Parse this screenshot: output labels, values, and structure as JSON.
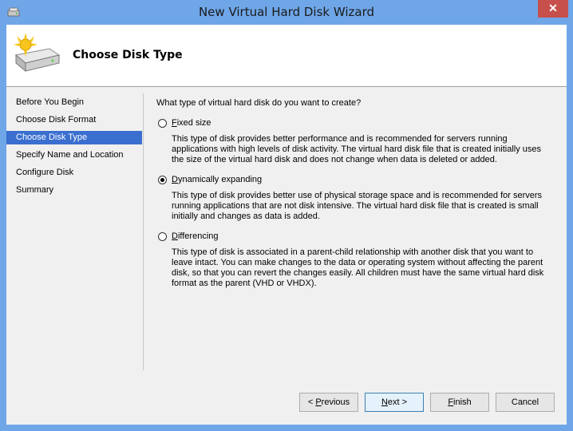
{
  "window": {
    "title": "New Virtual Hard Disk Wizard",
    "close_glyph": "✕",
    "title_icon": "hard-disk-icon"
  },
  "header": {
    "title": "Choose Disk Type",
    "icon": "new-hard-disk-icon"
  },
  "nav": {
    "items": [
      {
        "label": "Before You Begin",
        "selected": false
      },
      {
        "label": "Choose Disk Format",
        "selected": false
      },
      {
        "label": "Choose Disk Type",
        "selected": true
      },
      {
        "label": "Specify Name and Location",
        "selected": false
      },
      {
        "label": "Configure Disk",
        "selected": false
      },
      {
        "label": "Summary",
        "selected": false
      }
    ]
  },
  "main": {
    "question": "What type of virtual hard disk do you want to create?",
    "options": [
      {
        "label_accel": "F",
        "label_rest": "ixed size",
        "checked": false,
        "description": "This type of disk provides better performance and is recommended for servers running applications with high levels of disk activity. The virtual hard disk file that is created initially uses the size of the virtual hard disk and does not change when data is deleted or added."
      },
      {
        "label_accel": "D",
        "label_rest": "ynamically expanding",
        "checked": true,
        "description": "This type of disk provides better use of physical storage space and is recommended for servers running applications that are not disk intensive. The virtual hard disk file that is created is small initially and changes as data is added."
      },
      {
        "label_accel": "D",
        "label_rest": "ifferencing",
        "checked": false,
        "description": "This type of disk is associated in a parent-child relationship with another disk that you want to leave intact. You can make changes to the data or operating system without affecting the parent disk, so that you can revert the changes easily. All children must have the same virtual hard disk format as the parent (VHD or VHDX)."
      }
    ]
  },
  "buttons": {
    "previous": {
      "pre": "< ",
      "accel": "P",
      "post": "revious"
    },
    "next": {
      "pre": "",
      "accel": "N",
      "post": "ext >"
    },
    "finish": {
      "pre": "",
      "accel": "F",
      "post": "inish"
    },
    "cancel": {
      "label": "Cancel"
    }
  },
  "colors": {
    "title_bar": "#6fa6e8",
    "close_button": "#c7504c",
    "nav_selected": "#3a6fd0"
  }
}
